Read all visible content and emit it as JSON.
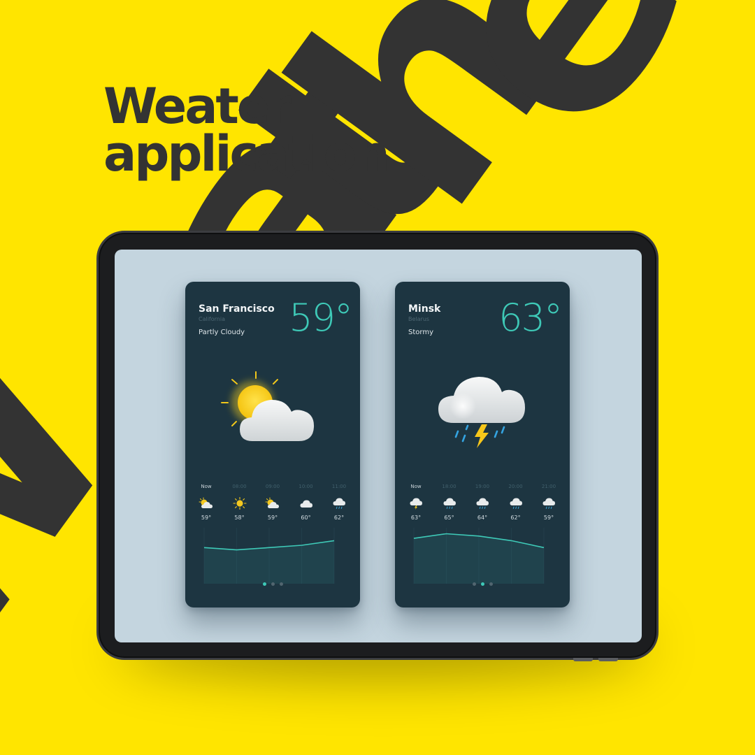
{
  "background": {
    "color": "#FFE500",
    "text_color": "#333333",
    "watermark_letters": [
      "W",
      "e",
      "a",
      "t",
      "h",
      "e"
    ]
  },
  "headline": {
    "line1": "Weater",
    "line2": "application"
  },
  "accent_color": "#3ec9b7",
  "card_color": "#1d3541",
  "cards": [
    {
      "city": "San Francisco",
      "region": "California",
      "condition": "Partly Cloudy",
      "temperature": "59",
      "degree": "°",
      "main_icon": "partly-cloudy-icon",
      "hourly": [
        {
          "time": "Now",
          "icon": "partly-cloudy-icon",
          "temp": "59°"
        },
        {
          "time": "08:00",
          "icon": "sun-icon",
          "temp": "58°"
        },
        {
          "time": "09:00",
          "icon": "partly-cloudy-icon",
          "temp": "59°"
        },
        {
          "time": "10:00",
          "icon": "cloud-icon",
          "temp": "60°"
        },
        {
          "time": "11:00",
          "icon": "rain-cloud-icon",
          "temp": "62°"
        }
      ],
      "temps_numeric": [
        59,
        58,
        59,
        60,
        62
      ],
      "page_dots": 3,
      "active_dot": 0
    },
    {
      "city": "Minsk",
      "region": "Belarus",
      "condition": "Stormy",
      "temperature": "63",
      "degree": "°",
      "main_icon": "storm-cloud-icon",
      "hourly": [
        {
          "time": "Now",
          "icon": "storm-cloud-icon",
          "temp": "63°"
        },
        {
          "time": "18:00",
          "icon": "rain-cloud-icon",
          "temp": "65°"
        },
        {
          "time": "19:00",
          "icon": "rain-cloud-icon",
          "temp": "64°"
        },
        {
          "time": "20:00",
          "icon": "rain-cloud-icon",
          "temp": "62°"
        },
        {
          "time": "21:00",
          "icon": "rain-cloud-icon",
          "temp": "59°"
        }
      ],
      "temps_numeric": [
        63,
        65,
        64,
        62,
        59
      ],
      "page_dots": 3,
      "active_dot": 1
    }
  ]
}
